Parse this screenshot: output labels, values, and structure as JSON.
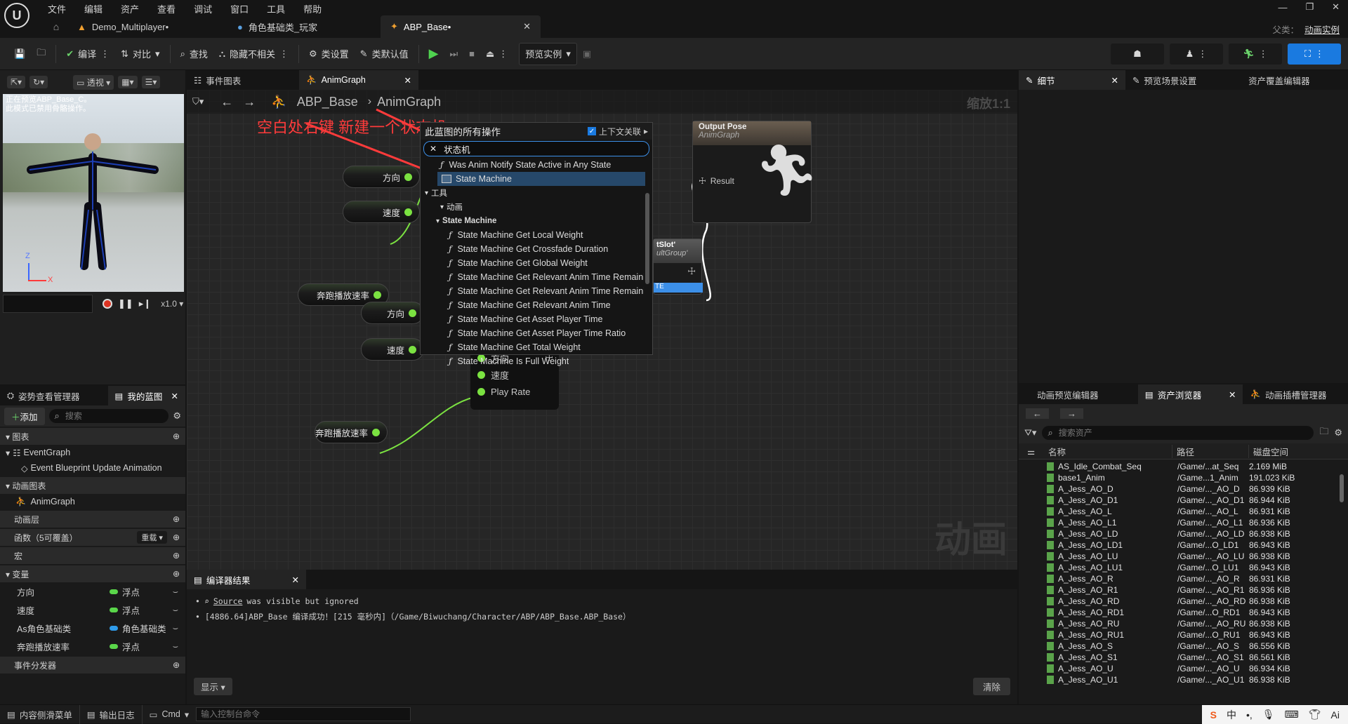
{
  "app": {
    "menu": [
      "文件",
      "编辑",
      "资产",
      "查看",
      "调试",
      "窗口",
      "工具",
      "帮助"
    ],
    "tabs": [
      {
        "label": "Demo_Multiplayer•"
      },
      {
        "label": "角色基础类_玩家"
      },
      {
        "label": "ABP_Base•"
      }
    ],
    "parent_label": "父类：",
    "parent_value": "动画实例"
  },
  "toolbar": {
    "compile": "编译",
    "diff": "对比",
    "find": "查找",
    "hide_unrelated": "隐藏不相关",
    "class_settings": "类设置",
    "class_defaults": "类默认值",
    "preview_instance": "预览实例"
  },
  "viewport": {
    "perspective": "透视",
    "overlay_text_1": "正在预览ABP_Base_C。",
    "overlay_text_2": "此模式已禁用骨骼操作。",
    "playback_speed": "x1.0",
    "axis_z": "Z",
    "axis_x": "X"
  },
  "left_panel": {
    "tabs": [
      "姿势查看管理器",
      "我的蓝图"
    ],
    "add_label": "添加",
    "search_placeholder": "搜索",
    "sections": {
      "graphs": "图表",
      "event_graph": "EventGraph",
      "event_update": "Event Blueprint Update Animation",
      "anim_graphs": "动画图表",
      "anim_graph": "AnimGraph",
      "anim_layers": "动画层",
      "functions": "函数（5可覆盖）",
      "override": "重载",
      "macros": "宏",
      "variables": "变量",
      "dispatchers": "事件分发器"
    },
    "variables": [
      {
        "name": "方向",
        "type": "浮点",
        "color": "#5ad64a"
      },
      {
        "name": "速度",
        "type": "浮点",
        "color": "#5ad64a"
      },
      {
        "name": "As角色基础类",
        "type": "角色基础类",
        "color": "#2f9bea"
      },
      {
        "name": "奔跑播放速率",
        "type": "浮点",
        "color": "#5ad64a"
      }
    ]
  },
  "graph": {
    "tabs": [
      "事件图表",
      "AnimGraph"
    ],
    "breadcrumb_root": "ABP_Base",
    "breadcrumb_leaf": "AnimGraph",
    "zoom": "缩放1:1",
    "watermark": "动画",
    "annotation": "空白处右键 新建一个状态机",
    "nodes": {
      "direction": "方向",
      "speed": "速度",
      "run_rate": "奔跑播放速率",
      "output_title": "Output Pose",
      "output_sub": "AnimGraph",
      "result": "Result",
      "slot_title": "tSlot'",
      "slot_sub": "ultGroup'",
      "slot_pin": "TE",
      "blend_pins": [
        "方向",
        "速度",
        "Play Rate"
      ]
    }
  },
  "context_menu": {
    "title": "此蓝图的所有操作",
    "context_sensitive": "上下文关联",
    "search_value": "状态机",
    "items": [
      {
        "label": "Was Anim Notify State Active in Any State",
        "kind": "fn",
        "indent": 1
      },
      {
        "label": "State Machine",
        "kind": "sm",
        "indent": 1,
        "selected": true
      },
      {
        "label": "工具",
        "kind": "cat",
        "indent": 0
      },
      {
        "label": "动画",
        "kind": "cat",
        "indent": 1
      },
      {
        "label": "State Machine",
        "kind": "cat",
        "indent": 2
      },
      {
        "label": "State Machine Get Local Weight",
        "kind": "fn",
        "indent": 3
      },
      {
        "label": "State Machine Get Crossfade Duration",
        "kind": "fn",
        "indent": 3
      },
      {
        "label": "State Machine Get Global Weight",
        "kind": "fn",
        "indent": 3
      },
      {
        "label": "State Machine Get Relevant Anim Time Remaining",
        "kind": "fn",
        "indent": 3
      },
      {
        "label": "State Machine Get Relevant Anim Time Remaining Fracti",
        "kind": "fn",
        "indent": 3
      },
      {
        "label": "State Machine Get Relevant Anim Time",
        "kind": "fn",
        "indent": 3
      },
      {
        "label": "State Machine Get Asset Player Time",
        "kind": "fn",
        "indent": 3
      },
      {
        "label": "State Machine Get Asset Player Time Ratio",
        "kind": "fn",
        "indent": 3
      },
      {
        "label": "State Machine Get Total Weight",
        "kind": "fn",
        "indent": 3
      },
      {
        "label": "State Machine Is Full Weight",
        "kind": "fn",
        "indent": 3
      }
    ]
  },
  "compiler": {
    "tab": "编译器结果",
    "line1_link": "Source",
    "line1_rest": "was visible but ignored",
    "line2": "[4886.64]ABP_Base 编译成功！[215 毫秒内]（/Game/Biwuchang/Character/ABP/ABP_Base.ABP_Base）",
    "show": "显示",
    "clear": "清除"
  },
  "right_panel": {
    "top_tabs": [
      "细节",
      "预览场景设置",
      "资产覆盖编辑器"
    ],
    "bottom_tabs": [
      "动画预览编辑器",
      "资产浏览器",
      "动画插槽管理器"
    ],
    "search_placeholder": "搜索资产",
    "columns": [
      "名称",
      "路径",
      "磁盘空间"
    ],
    "assets": [
      [
        "AS_Idle_Combat_Seq",
        "/Game/...at_Seq",
        "2.169 MiB"
      ],
      [
        "base1_Anim",
        "/Game...1_Anim",
        "191.023 KiB"
      ],
      [
        "A_Jess_AO_D",
        "/Game/..._AO_D",
        "86.939 KiB"
      ],
      [
        "A_Jess_AO_D1",
        "/Game/..._AO_D1",
        "86.944 KiB"
      ],
      [
        "A_Jess_AO_L",
        "/Game/..._AO_L",
        "86.931 KiB"
      ],
      [
        "A_Jess_AO_L1",
        "/Game/..._AO_L1",
        "86.936 KiB"
      ],
      [
        "A_Jess_AO_LD",
        "/Game/..._AO_LD",
        "86.938 KiB"
      ],
      [
        "A_Jess_AO_LD1",
        "/Game/...O_LD1",
        "86.943 KiB"
      ],
      [
        "A_Jess_AO_LU",
        "/Game/..._AO_LU",
        "86.938 KiB"
      ],
      [
        "A_Jess_AO_LU1",
        "/Game/...O_LU1",
        "86.943 KiB"
      ],
      [
        "A_Jess_AO_R",
        "/Game/..._AO_R",
        "86.931 KiB"
      ],
      [
        "A_Jess_AO_R1",
        "/Game/..._AO_R1",
        "86.936 KiB"
      ],
      [
        "A_Jess_AO_RD",
        "/Game/..._AO_RD",
        "86.938 KiB"
      ],
      [
        "A_Jess_AO_RD1",
        "/Game/...O_RD1",
        "86.943 KiB"
      ],
      [
        "A_Jess_AO_RU",
        "/Game/..._AO_RU",
        "86.938 KiB"
      ],
      [
        "A_Jess_AO_RU1",
        "/Game/...O_RU1",
        "86.943 KiB"
      ],
      [
        "A_Jess_AO_S",
        "/Game/..._AO_S",
        "86.556 KiB"
      ],
      [
        "A_Jess_AO_S1",
        "/Game/..._AO_S1",
        "86.561 KiB"
      ],
      [
        "A_Jess_AO_U",
        "/Game/..._AO_U",
        "86.934 KiB"
      ],
      [
        "A_Jess_AO_U1",
        "/Game/..._AO_U1",
        "86.938 KiB"
      ]
    ]
  },
  "statusbar": {
    "content_drawer": "内容侧滑菜单",
    "output_log": "输出日志",
    "cmd": "Cmd",
    "console_placeholder": "输入控制台命令"
  },
  "ime": {
    "mode": "中",
    "ai": "Ai"
  }
}
